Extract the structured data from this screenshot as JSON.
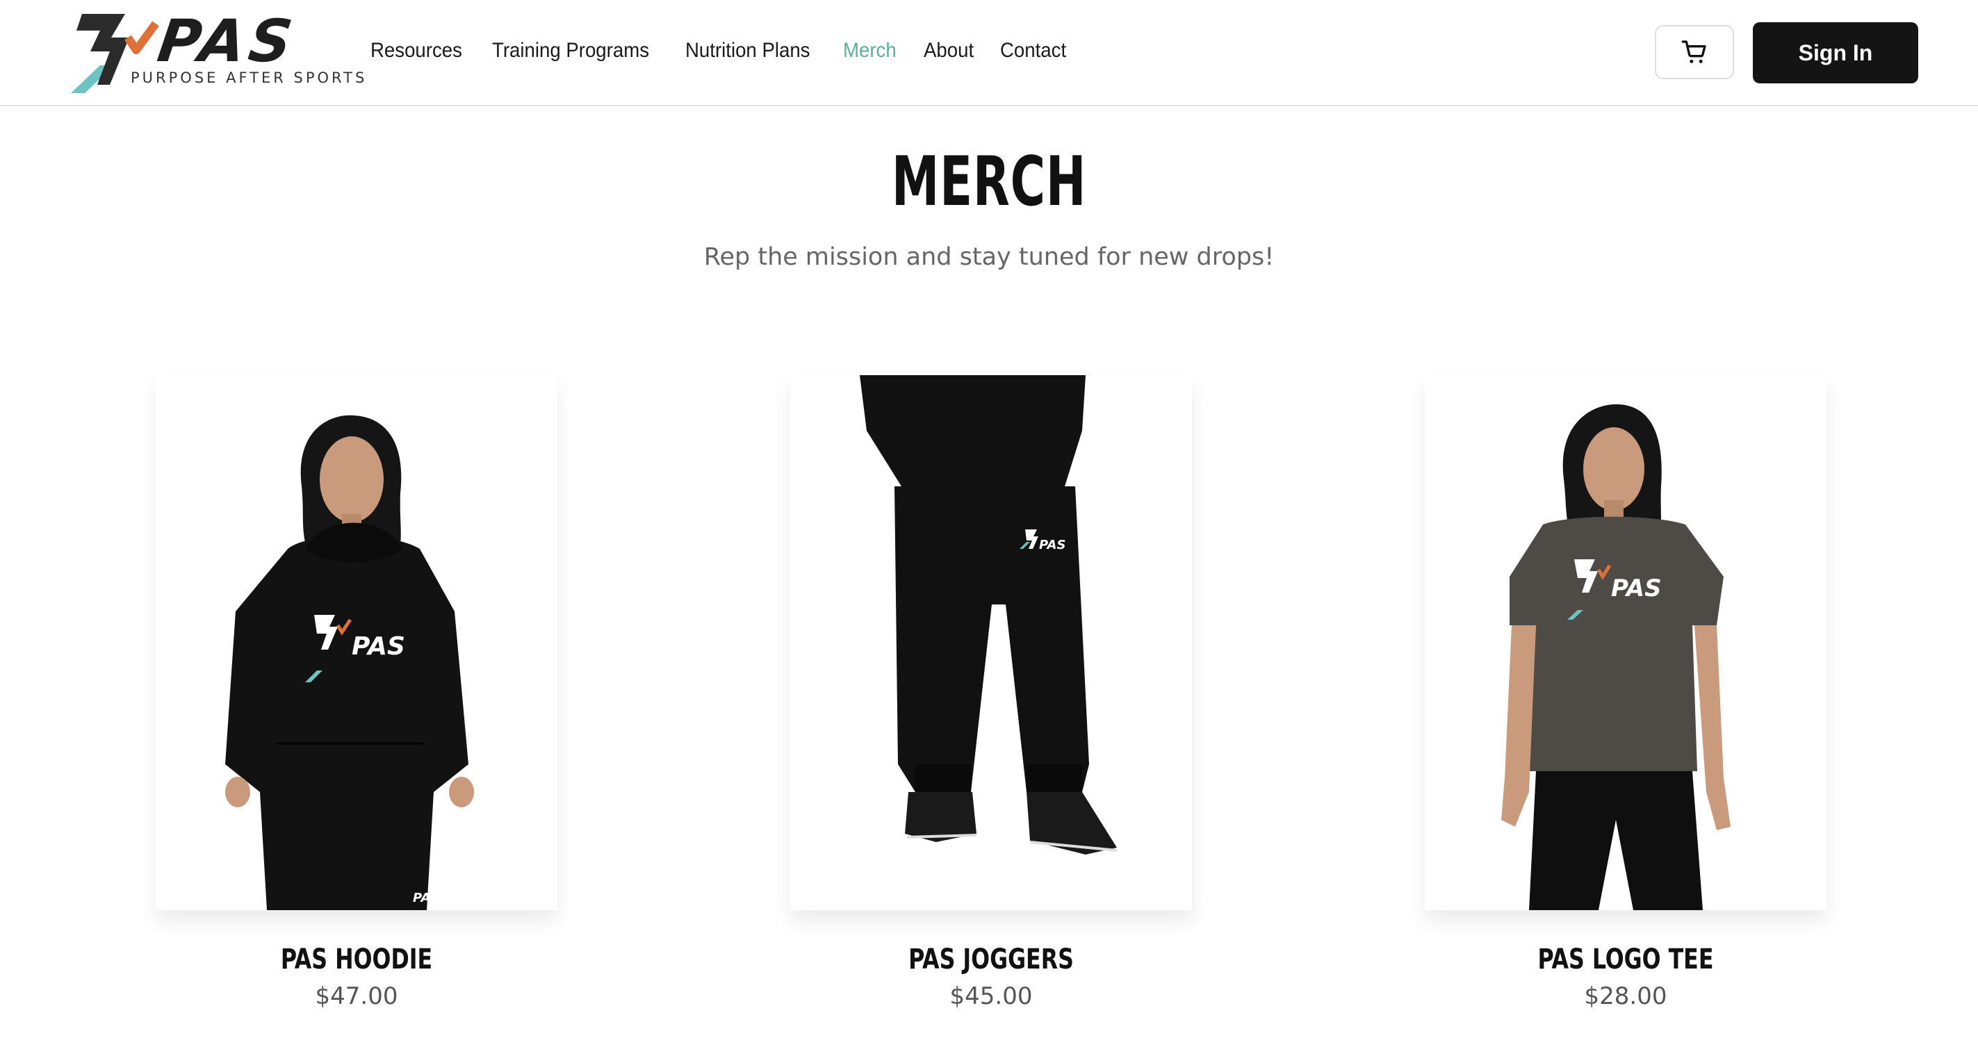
{
  "brand": {
    "wordmark": "PAS",
    "tagline": "PURPOSE AFTER SPORTS"
  },
  "nav": {
    "items": [
      {
        "label": "Resources",
        "active": false
      },
      {
        "label": "Training Programs",
        "active": false
      },
      {
        "label": "Nutrition Plans",
        "active": false
      },
      {
        "label": "Merch",
        "active": true
      },
      {
        "label": "About",
        "active": false
      },
      {
        "label": "Contact",
        "active": false
      }
    ]
  },
  "header": {
    "cart_icon": "shopping-cart-icon",
    "signin_label": "Sign In"
  },
  "hero": {
    "title": "MERCH",
    "subtitle": "Rep the mission and stay tuned for new drops!"
  },
  "products": [
    {
      "name": "PAS HOODIE",
      "price": "$47.00"
    },
    {
      "name": "PAS JOGGERS",
      "price": "$45.00"
    },
    {
      "name": "PAS LOGO TEE",
      "price": "$28.00"
    }
  ],
  "colors": {
    "accent_teal": "#5fae98",
    "accent_orange": "#e0703a",
    "button_dark": "#141414",
    "text_muted": "#666666"
  }
}
